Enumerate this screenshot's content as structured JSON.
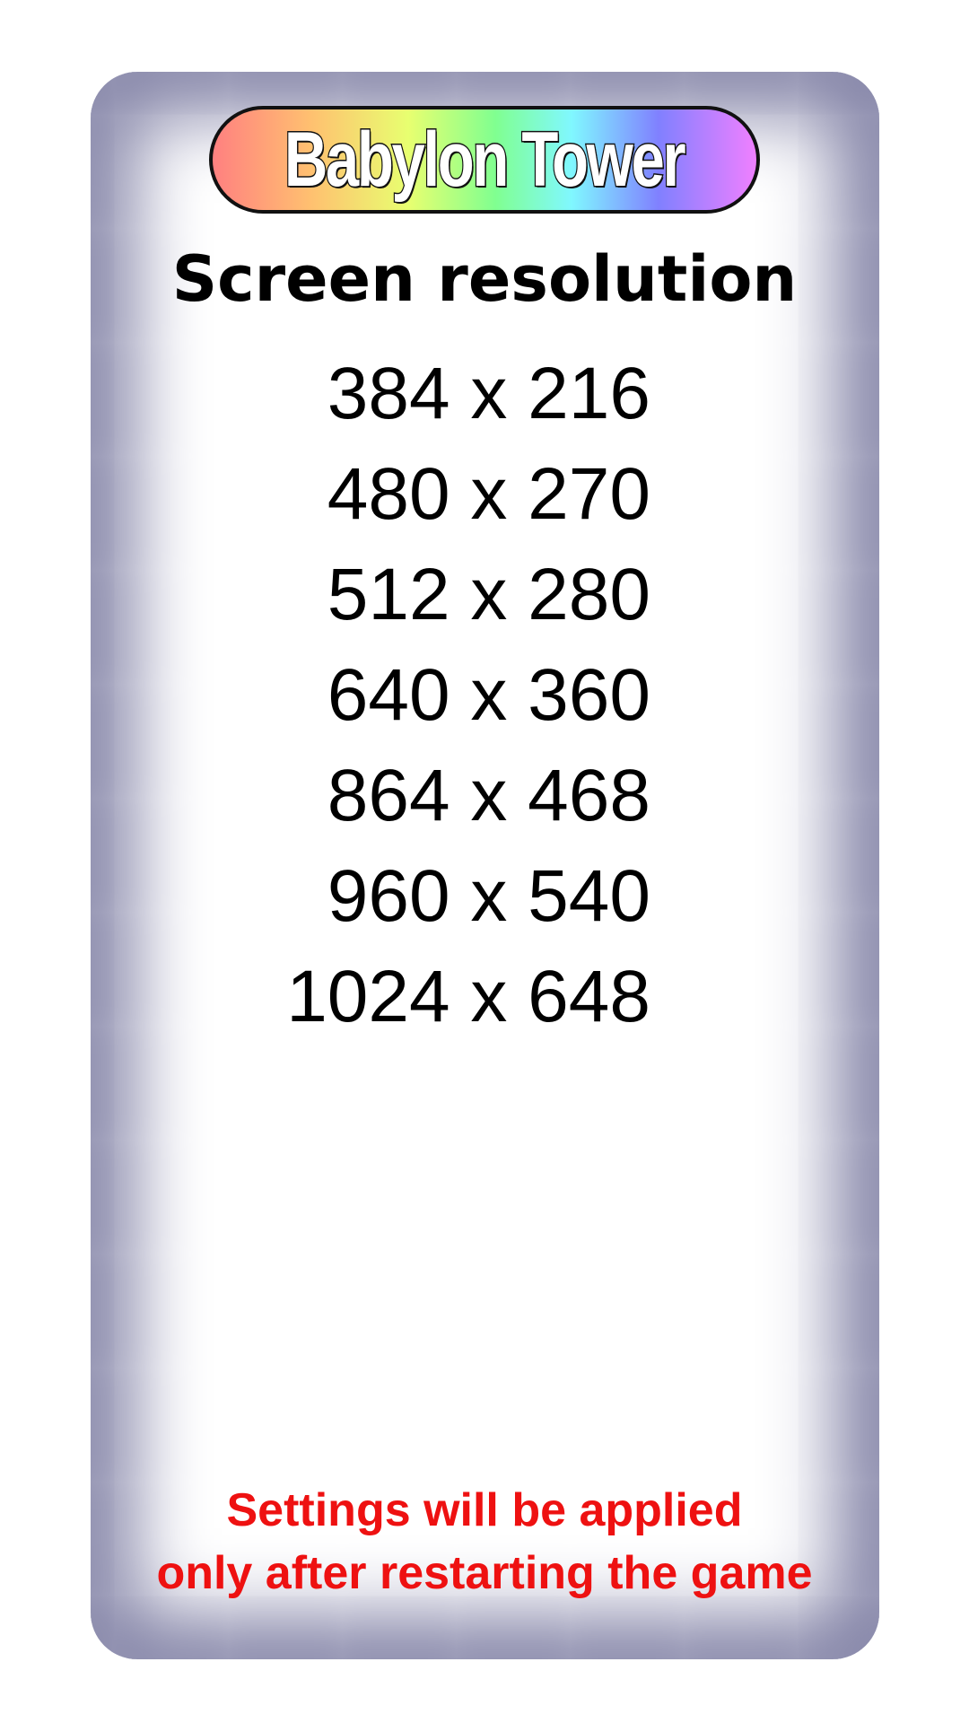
{
  "app": {
    "logo_text": "Babylon Tower"
  },
  "screen": {
    "title": "Screen resolution",
    "resolutions": [
      {
        "label": "384 x 216"
      },
      {
        "label": "480 x 270"
      },
      {
        "label": "512 x 280"
      },
      {
        "label": "640 x 360"
      },
      {
        "label": "864 x 468"
      },
      {
        "label": "960 x 540"
      },
      {
        "label": "1024 x 648"
      }
    ],
    "notice_line1": "Settings will be applied",
    "notice_line2": "only after restarting the game"
  },
  "colors": {
    "panel_border": "#8585a8",
    "notice": "#ee1111",
    "text": "#000000"
  }
}
